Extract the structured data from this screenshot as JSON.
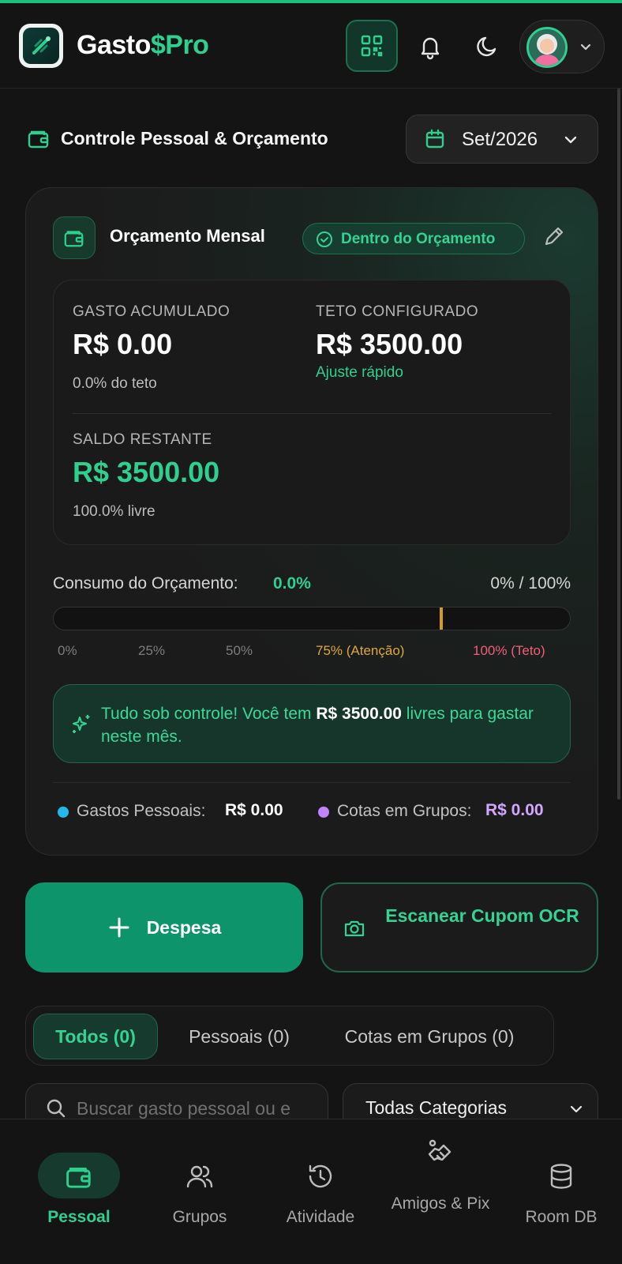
{
  "header": {
    "brand_part1": "Gasto",
    "brand_part2": "$Pro",
    "icons": [
      "wallet-logo-icon",
      "qr-code-icon",
      "bell-icon",
      "moon-icon",
      "chevron-down-icon"
    ]
  },
  "section": {
    "title": "Controle Pessoal & Orçamento",
    "month": "Set/2026"
  },
  "budget": {
    "title": "Orçamento Mensal",
    "status": "Dentro do Orçamento",
    "spent_label": "GASTO ACUMULADO",
    "spent_value": "R$ 0.00",
    "spent_pct": "0.0% do teto",
    "cap_label": "TETO CONFIGURADO",
    "cap_value": "R$ 3500.00",
    "cap_link": "Ajuste rápido",
    "remaining_label": "SALDO RESTANTE",
    "remaining_value": "R$ 3500.00",
    "remaining_pct": "100.0% livre",
    "consumption_label": "Consumo do Orçamento:",
    "consumption_value": "0.0%",
    "consumption_range": "0% / 100%",
    "consumption_fraction": 0.0,
    "warning_threshold": 0.75,
    "ticks": [
      "0%",
      "25%",
      "50%",
      "75% (Atenção)",
      "100% (Teto)"
    ],
    "alert_prefix": "Tudo sob controle! Você tem ",
    "alert_amount": "R$ 3500.00",
    "alert_suffix": " livres para gastar neste mês.",
    "legend": {
      "personal_label": "Gastos Pessoais:",
      "personal_value": "R$ 0.00",
      "personal_color": "#22b8e8",
      "groups_label": "Cotas em Grupos:",
      "groups_value": "R$ 0.00",
      "groups_color": "#c084fc"
    }
  },
  "actions": {
    "add_label": "Despesa",
    "scan_label": "Escanear Cupom OCR"
  },
  "tabs": [
    {
      "label": "Todos (0)",
      "active": true
    },
    {
      "label": "Pessoais (0)",
      "active": false
    },
    {
      "label": "Cotas em Grupos (0)",
      "active": false
    }
  ],
  "search": {
    "placeholder": "Buscar gasto pessoal ou e"
  },
  "filter": {
    "selected": "Todas Categorias"
  },
  "bottom_nav": [
    {
      "label": "Pessoal",
      "icon": "wallet-icon",
      "active": true
    },
    {
      "label": "Grupos",
      "icon": "users-icon",
      "active": false
    },
    {
      "label": "Atividade",
      "icon": "history-icon",
      "active": false
    },
    {
      "label": "Amigos & Pix",
      "icon": "handshake-icon",
      "active": false
    },
    {
      "label": "Room DB",
      "icon": "database-icon",
      "active": false
    }
  ],
  "colors": {
    "accent": "#2fd08e",
    "primary_button": "#0d946a",
    "warning": "#e0a83a",
    "danger": "#ef5f7a"
  }
}
